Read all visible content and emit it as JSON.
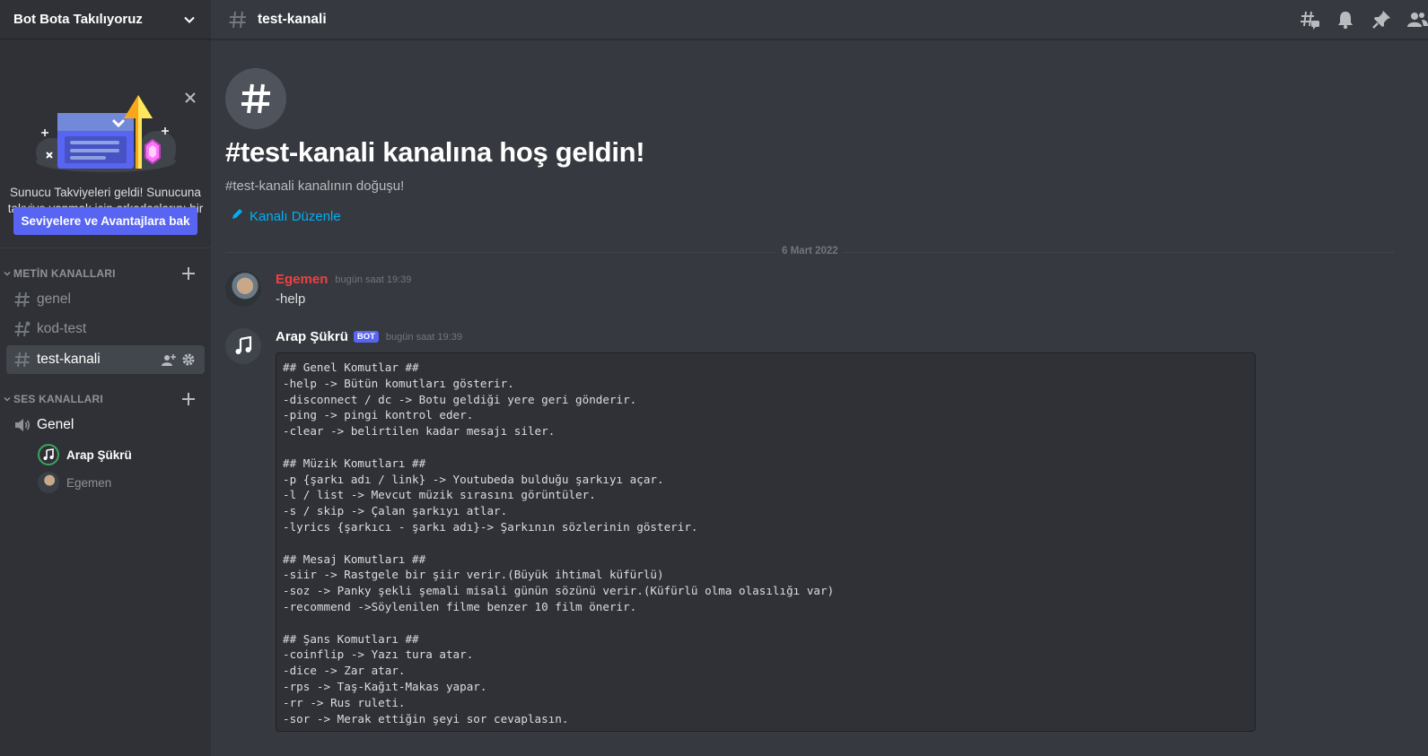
{
  "server": {
    "name": "Bot Bota Takılıyoruz"
  },
  "boost": {
    "text": "Sunucu Takviyeleri geldi! Sunucuna takviye yapmak için arkadaşlarını bir araya getir.",
    "button_label": "Seviyelere ve Avantajlara bak"
  },
  "sidebar": {
    "text_category": "METİN KANALLARI",
    "voice_category": "SES KANALLARI",
    "text_channels": [
      {
        "name": "genel"
      },
      {
        "name": "kod-test"
      },
      {
        "name": "test-kanali"
      }
    ],
    "voice_channel": {
      "name": "Genel"
    },
    "voice_users": [
      {
        "name": "Arap Şükrü"
      },
      {
        "name": "Egemen"
      }
    ]
  },
  "header": {
    "channel_name": "test-kanali"
  },
  "welcome": {
    "title": "#test-kanali kanalına hoş geldin!",
    "subtitle": "#test-kanali kanalının doğuşu!",
    "edit_label": "Kanalı Düzenle"
  },
  "date_divider": "6 Mart 2022",
  "messages": [
    {
      "author": "Egemen",
      "time": "bugün saat 19:39",
      "text": "-help",
      "author_color": "#ed4245"
    },
    {
      "author": "Arap Şükrü",
      "tag": "BOT",
      "time": "bugün saat 19:39",
      "code": "## Genel Komutlar ##\n-help -> Bütün komutları gösterir.\n-disconnect / dc -> Botu geldiği yere geri gönderir.\n-ping -> pingi kontrol eder.\n-clear -> belirtilen kadar mesajı siler.\n\n## Müzik Komutları ##\n-p {şarkı adı / link} -> Youtubeda bulduğu şarkıyı açar.\n-l / list -> Mevcut müzik sırasını görüntüler.\n-s / skip -> Çalan şarkıyı atlar.\n-lyrics {şarkıcı - şarkı adı}-> Şarkının sözlerinin gösterir.\n\n## Mesaj Komutları ##\n-siir -> Rastgele bir şiir verir.(Büyük ihtimal küfürlü)\n-soz -> Panky şekli şemali misali günün sözünü verir.(Küfürlü olma olasılığı var)\n-recommend ->Söylenilen filme benzer 10 film önerir.\n\n## Şans Komutları ##\n-coinflip -> Yazı tura atar.\n-dice -> Zar atar.\n-rps -> Taş-Kağıt-Makas yapar.\n-rr -> Rus ruleti.\n-sor -> Merak ettiğin şeyi sor cevaplasın."
    }
  ],
  "colors": {
    "accent": "#5865f2",
    "link": "#00aff4",
    "background": "#36393f",
    "sidebar": "#2f3136"
  },
  "icons": [
    "chevron-down-icon",
    "close-icon",
    "hash-icon",
    "plus-icon",
    "add-member-icon",
    "gear-icon",
    "speaker-icon",
    "threads-icon",
    "bell-icon",
    "pin-icon",
    "members-icon",
    "pencil-icon",
    "music-note-icon"
  ]
}
